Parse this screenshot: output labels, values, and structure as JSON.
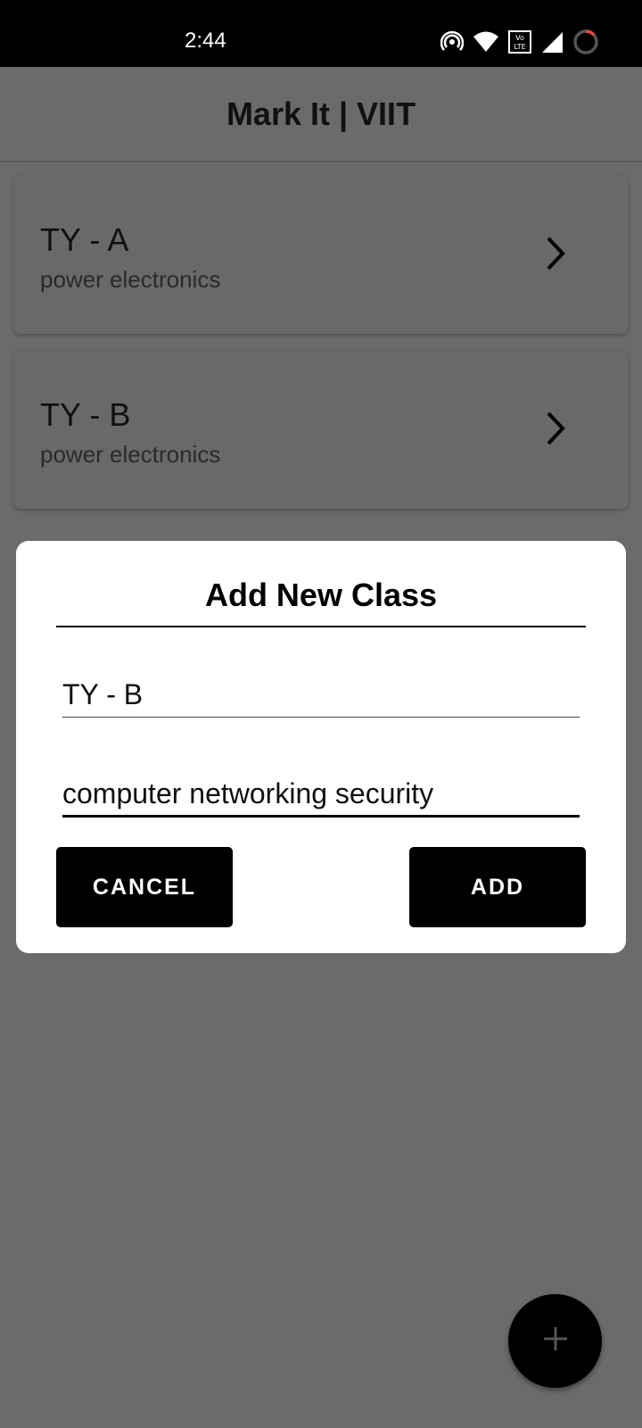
{
  "status_bar": {
    "time": "2:44",
    "icons": [
      "hotspot-icon",
      "wifi-icon",
      "volte-icon",
      "signal-icon",
      "battery-icon"
    ]
  },
  "app_bar": {
    "title": "Mark It | VIIT"
  },
  "classes": [
    {
      "title": "TY - A",
      "subject": "power electronics"
    },
    {
      "title": "TY - B",
      "subject": "power electronics"
    }
  ],
  "dialog": {
    "title": "Add New Class",
    "class_name_value": "TY - B",
    "subject_value": "computer networking security",
    "cancel_label": "CANCEL",
    "add_label": "ADD"
  },
  "fab": {
    "icon": "plus-icon"
  },
  "colors": {
    "scrim": "#6b6b6b",
    "dialog_bg": "#ffffff",
    "button_bg": "#000000"
  }
}
